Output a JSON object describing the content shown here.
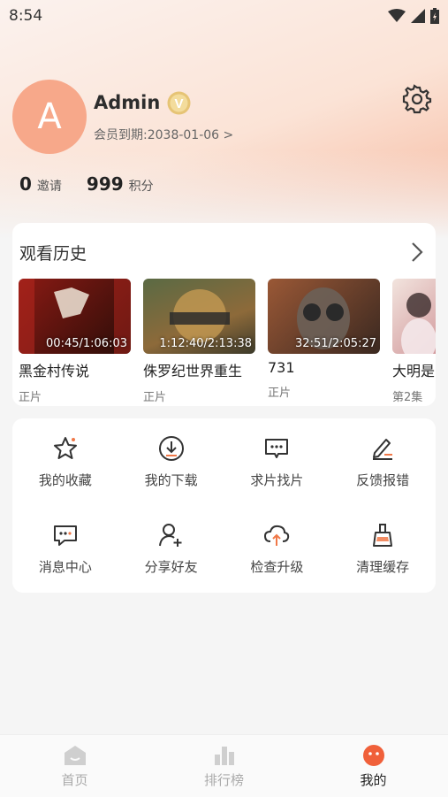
{
  "status_bar": {
    "time": "8:54"
  },
  "profile": {
    "avatar_letter": "A",
    "username": "Admin",
    "badge_letter": "V",
    "expiry": "会员到期:2038-01-06 >"
  },
  "stats": [
    {
      "value": "0",
      "label": "邀请"
    },
    {
      "value": "999",
      "label": "积分"
    }
  ],
  "history": {
    "title": "观看历史",
    "items": [
      {
        "title": "黑金村传说",
        "progress": "00:45/1:06:03",
        "sub": "正片",
        "colors": [
          "#7a1414",
          "#1a0d0a"
        ]
      },
      {
        "title": "侏罗纪世界重生",
        "progress": "1:12:40/2:13:38",
        "sub": "正片",
        "colors": [
          "#4f5a3c",
          "#b98a4a"
        ]
      },
      {
        "title": "731",
        "progress": "32:51/2:05:27",
        "sub": "正片",
        "colors": [
          "#3a2a22",
          "#a06040"
        ]
      },
      {
        "title": "大明是",
        "progress": "",
        "sub": "第2集",
        "colors": [
          "#e8d7d0",
          "#a0505a"
        ]
      }
    ]
  },
  "menu": [
    {
      "label": "我的收藏",
      "icon": "star-icon"
    },
    {
      "label": "我的下载",
      "icon": "download-icon"
    },
    {
      "label": "求片找片",
      "icon": "chat-request-icon"
    },
    {
      "label": "反馈报错",
      "icon": "edit-feedback-icon"
    },
    {
      "label": "消息中心",
      "icon": "message-icon"
    },
    {
      "label": "分享好友",
      "icon": "add-user-icon"
    },
    {
      "label": "检查升级",
      "icon": "cloud-upload-icon"
    },
    {
      "label": "清理缓存",
      "icon": "clean-brush-icon"
    }
  ],
  "tabs": [
    {
      "label": "首页",
      "icon": "home-icon"
    },
    {
      "label": "排行榜",
      "icon": "chart-icon"
    },
    {
      "label": "我的",
      "icon": "profile-face-icon"
    }
  ],
  "colors": {
    "accent": "#f07848",
    "avatar": "#f7a88a",
    "badge": "#e6c475"
  }
}
